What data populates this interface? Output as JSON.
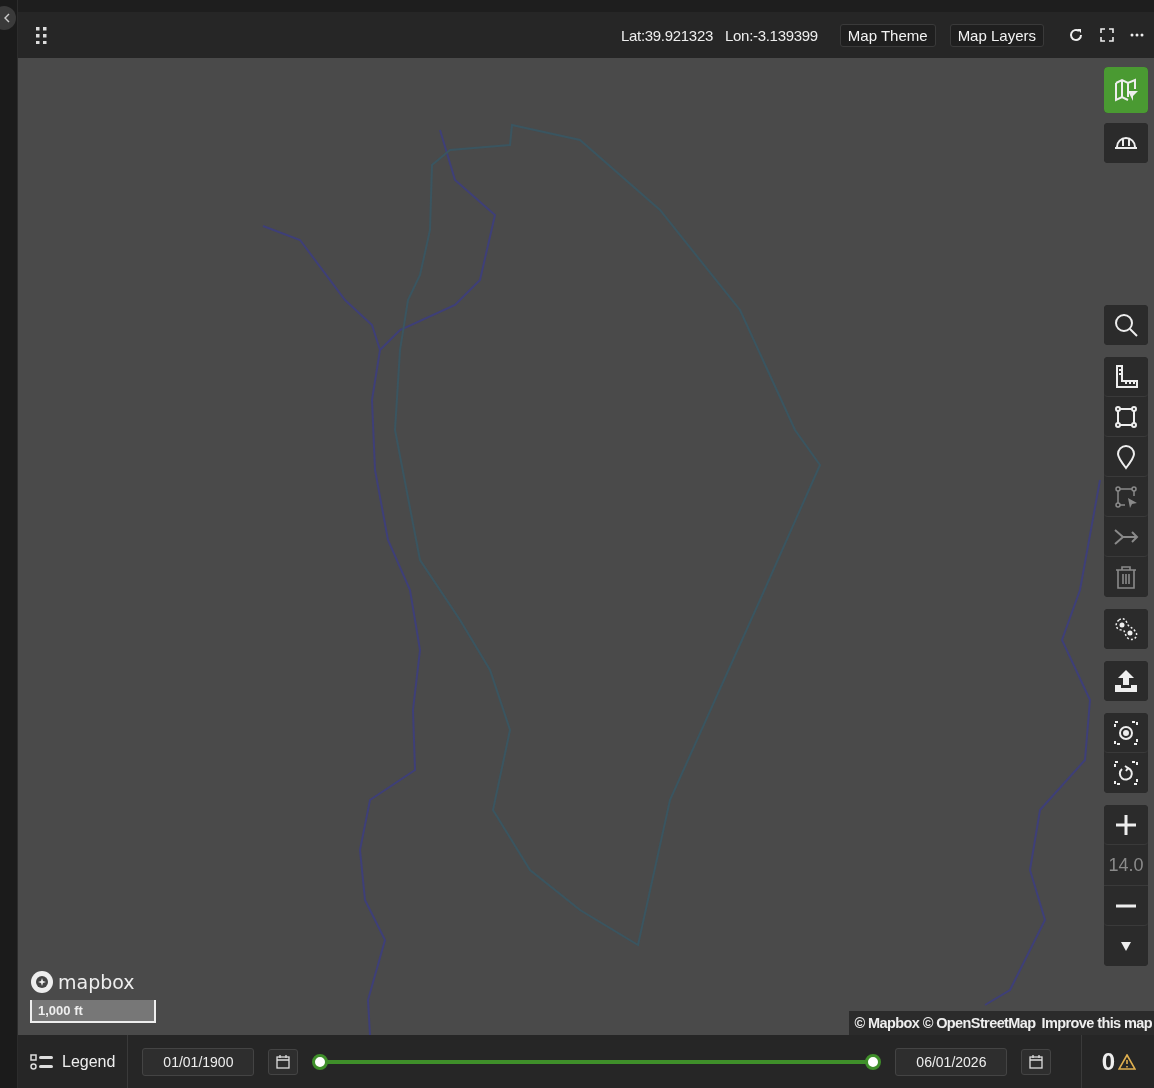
{
  "top_bar": {
    "latitude": "Lat:39.921323",
    "longitude": "Lon:-3.139399",
    "buttons": [
      {
        "label": "Map Theme"
      },
      {
        "label": "Map Layers"
      }
    ]
  },
  "map": {
    "kind": "picture",
    "tool_groups": [
      [
        {
          "kind": "map-filter",
          "selected": true,
          "disabled": false
        }
      ],
      [
        {
          "kind": "helmet",
          "selected": false,
          "disabled": false
        }
      ],
      [
        {
          "kind": "search",
          "selected": false,
          "disabled": false
        }
      ],
      [
        {
          "kind": "ruler",
          "selected": false,
          "disabled": false
        },
        {
          "kind": "polygon",
          "selected": false,
          "disabled": false
        },
        {
          "kind": "pin",
          "selected": false,
          "disabled": false
        },
        {
          "kind": "select",
          "selected": false,
          "disabled": true
        },
        {
          "kind": "merge",
          "selected": false,
          "disabled": true
        },
        {
          "kind": "trash",
          "selected": false,
          "disabled": true
        }
      ],
      [
        {
          "kind": "lasso",
          "selected": false,
          "disabled": false
        }
      ],
      [
        {
          "kind": "upload",
          "selected": false,
          "disabled": false
        }
      ],
      [
        {
          "kind": "locate",
          "selected": false,
          "disabled": false
        },
        {
          "kind": "rotate",
          "selected": false,
          "disabled": false
        }
      ],
      [
        {
          "kind": "zoom-in",
          "selected": false,
          "disabled": false
        },
        {
          "kind": "zoom-level",
          "text": "14.0",
          "disabled": true
        },
        {
          "kind": "zoom-out",
          "selected": false,
          "disabled": false
        },
        {
          "kind": "down",
          "selected": false,
          "disabled": false
        }
      ]
    ],
    "logo": "mapbox",
    "scale": "1,000 ft",
    "attribution": "© Mapbox © OpenStreetMap",
    "improve_link": "Improve this map"
  },
  "bottom_bar": {
    "legend": "Legend",
    "start_date": "01/01/1900",
    "end_date": "06/01/2026",
    "handles": [
      {
        "level": 0
      },
      {
        "level": 1
      }
    ],
    "warning_count": "0"
  }
}
